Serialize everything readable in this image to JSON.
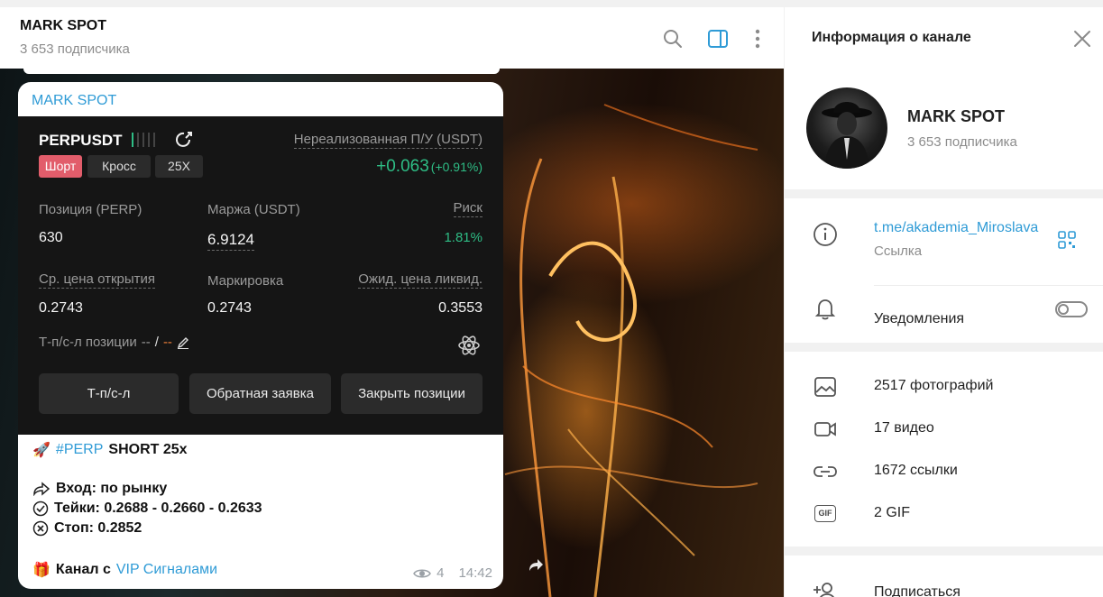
{
  "chat_header": {
    "title": "MARK SPOT",
    "subtitle": "3 653 подписчика",
    "icons": [
      "search-icon",
      "sidebar-toggle-icon",
      "more-vertical-icon"
    ]
  },
  "message": {
    "author": "MARK SPOT",
    "card": {
      "symbol": "PERPUSDT",
      "pnl_label": "Нереализованная П/У (USDT)",
      "pnl_value": "+0.063",
      "pnl_percent": "(+0.91%)",
      "tags": {
        "side": "Шорт",
        "margin_mode": "Кросс",
        "leverage": "25X"
      },
      "position_label": "Позиция (PERP)",
      "position_value": "630",
      "margin_label": "Маржа (USDT)",
      "margin_value": "6.9124",
      "risk_label": "Риск",
      "risk_value": "1.81%",
      "entry_label": "Ср. цена открытия",
      "entry_value": "0.2743",
      "mark_label": "Маркировка",
      "mark_value": "0.2743",
      "liq_label": "Ожид. цена ликвид.",
      "liq_value": "0.3553",
      "tpsl_label": "Т-п/с-л позиции",
      "tpsl_value_1": "--",
      "tpsl_sep": "/",
      "tpsl_value_2": "--",
      "buttons": {
        "tpsl": "Т-п/с-л",
        "reverse": "Обратная заявка",
        "close": "Закрыть позиции"
      },
      "colors": {
        "short": "#e25d6b",
        "profit": "#2ebd85",
        "tpsl_value": "#f0813a"
      }
    },
    "text": {
      "hashtag": "#PERP",
      "signal": "SHORT 25x",
      "entry": "Вход: по рынку",
      "takes": "Тейки: 0.2688 - 0.2660 - 0.2633",
      "stop": "Стоп: 0.2852",
      "channel_prefix": "Канал с",
      "channel_link": "VIP Сигналами"
    },
    "views": "4",
    "time": "14:42"
  },
  "info_panel": {
    "title": "Информация о канале",
    "channel_name": "MARK SPOT",
    "channel_subtitle": "3 653 подписчика",
    "link": "t.me/akademia_Miroslava",
    "link_caption": "Ссылка",
    "notifications_label": "Уведомления",
    "notifications_on": false,
    "media": {
      "photos": "2517 фотографий",
      "videos": "17 видео",
      "links": "1672 ссылки",
      "gifs": "2 GIF",
      "gif_badge": "GIF"
    },
    "subscribe": "Подписаться"
  },
  "colors": {
    "accent": "#2f9bd6",
    "muted": "#8c8c8c"
  }
}
